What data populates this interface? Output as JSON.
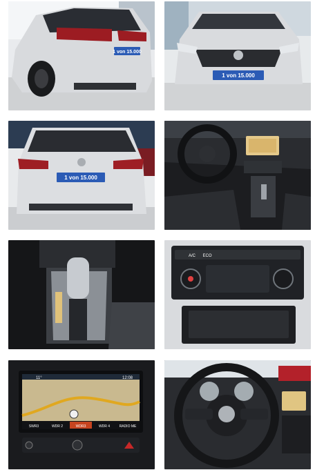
{
  "gallery": {
    "photos": [
      {
        "subject": "rear-three-quarter-exterior",
        "plate_text": "1 von 15.000"
      },
      {
        "subject": "front-exterior",
        "plate_text": "1 von 15.000"
      },
      {
        "subject": "rear-exterior",
        "plate_text": "1 von 15.000"
      },
      {
        "subject": "dashboard-interior"
      },
      {
        "subject": "gear-shifter"
      },
      {
        "subject": "climate-control-panel",
        "control_labels": [
          "A/C",
          "ECO"
        ]
      },
      {
        "subject": "navigation-screen",
        "screen": {
          "time": "11°",
          "clock": "12:08",
          "buttons": [
            "SWR3",
            "WDR 2",
            "WDR3",
            "WDR 4",
            "RADIO ME"
          ]
        }
      },
      {
        "subject": "steering-wheel"
      }
    ]
  },
  "colors": {
    "plate_blue": "#2b5bb5",
    "car_silver": "#d7d9dc",
    "interior_dark": "#1c1d20"
  }
}
